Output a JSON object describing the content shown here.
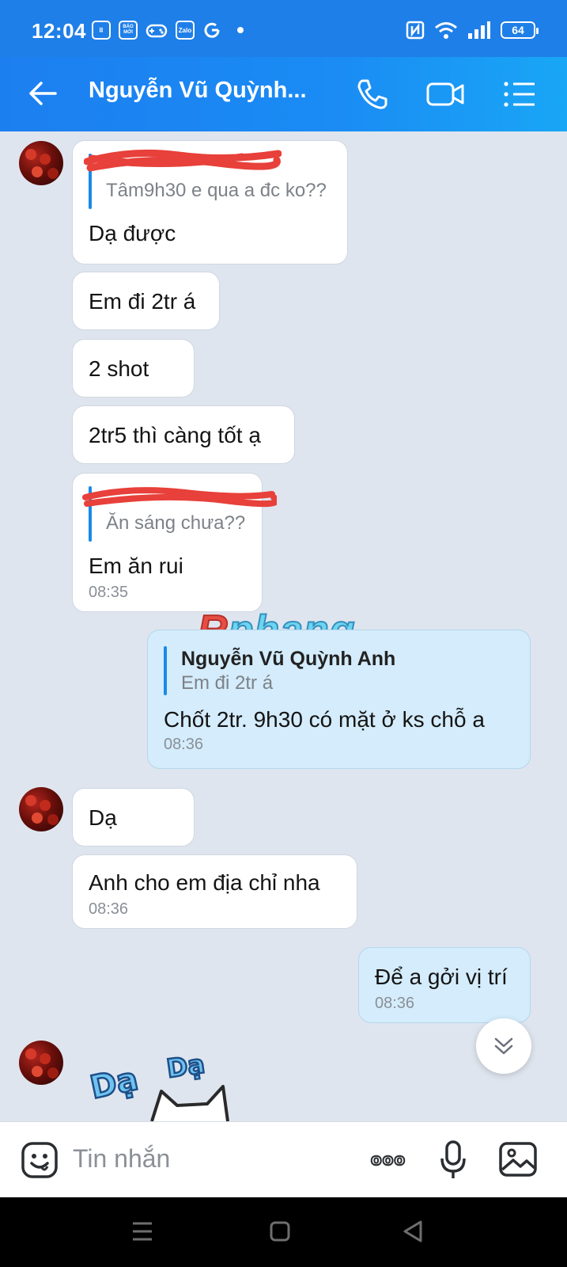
{
  "status_bar": {
    "time": "12:04",
    "apps": [
      "calc",
      "BÁO MỚI",
      "game",
      "Zalo",
      "G"
    ],
    "battery": "64"
  },
  "header": {
    "contact_name": "Nguyễn Vũ Quỳnh..."
  },
  "messages": {
    "m1": {
      "quote_text": "Tâm9h30 e qua a đc ko??",
      "text": "Dạ được"
    },
    "m2": {
      "text": "Em đi 2tr á"
    },
    "m3": {
      "text": "2 shot"
    },
    "m4": {
      "text": "2tr5 thì càng tốt ạ"
    },
    "m5": {
      "quote_text": "Ăn sáng chưa??",
      "text": "Em ăn rui",
      "time": "08:35"
    },
    "m6": {
      "quote_name": "Nguyễn Vũ Quỳnh Anh",
      "quote_text": "Em đi 2tr á",
      "text": "Chốt 2tr. 9h30 có mặt ở ks chỗ a",
      "time": "08:36"
    },
    "m7": {
      "text": "Dạ"
    },
    "m8": {
      "text": "Anh cho em địa chỉ nha",
      "time": "08:36"
    },
    "m9": {
      "text": "Để a gởi vị trí",
      "time": "08:36"
    }
  },
  "sticker": {
    "text_1": "Dạ",
    "text_2": "Dạ"
  },
  "watermark": {
    "r": "R",
    "rest": "phang"
  },
  "input": {
    "placeholder": "Tin nhắn",
    "more_label": "ooo"
  },
  "colors": {
    "header": "#1a8cf4",
    "background": "#dfe5ee",
    "incoming_bubble": "#ffffff",
    "outgoing_bubble": "#d4ecfb",
    "quote_bar": "#1a8ae8",
    "redaction": "#e8403a"
  },
  "icons": [
    "back-arrow-icon",
    "phone-icon",
    "video-call-icon",
    "menu-list-icon",
    "scroll-down-icon",
    "emoji-icon",
    "more-icon",
    "microphone-icon",
    "image-icon"
  ]
}
